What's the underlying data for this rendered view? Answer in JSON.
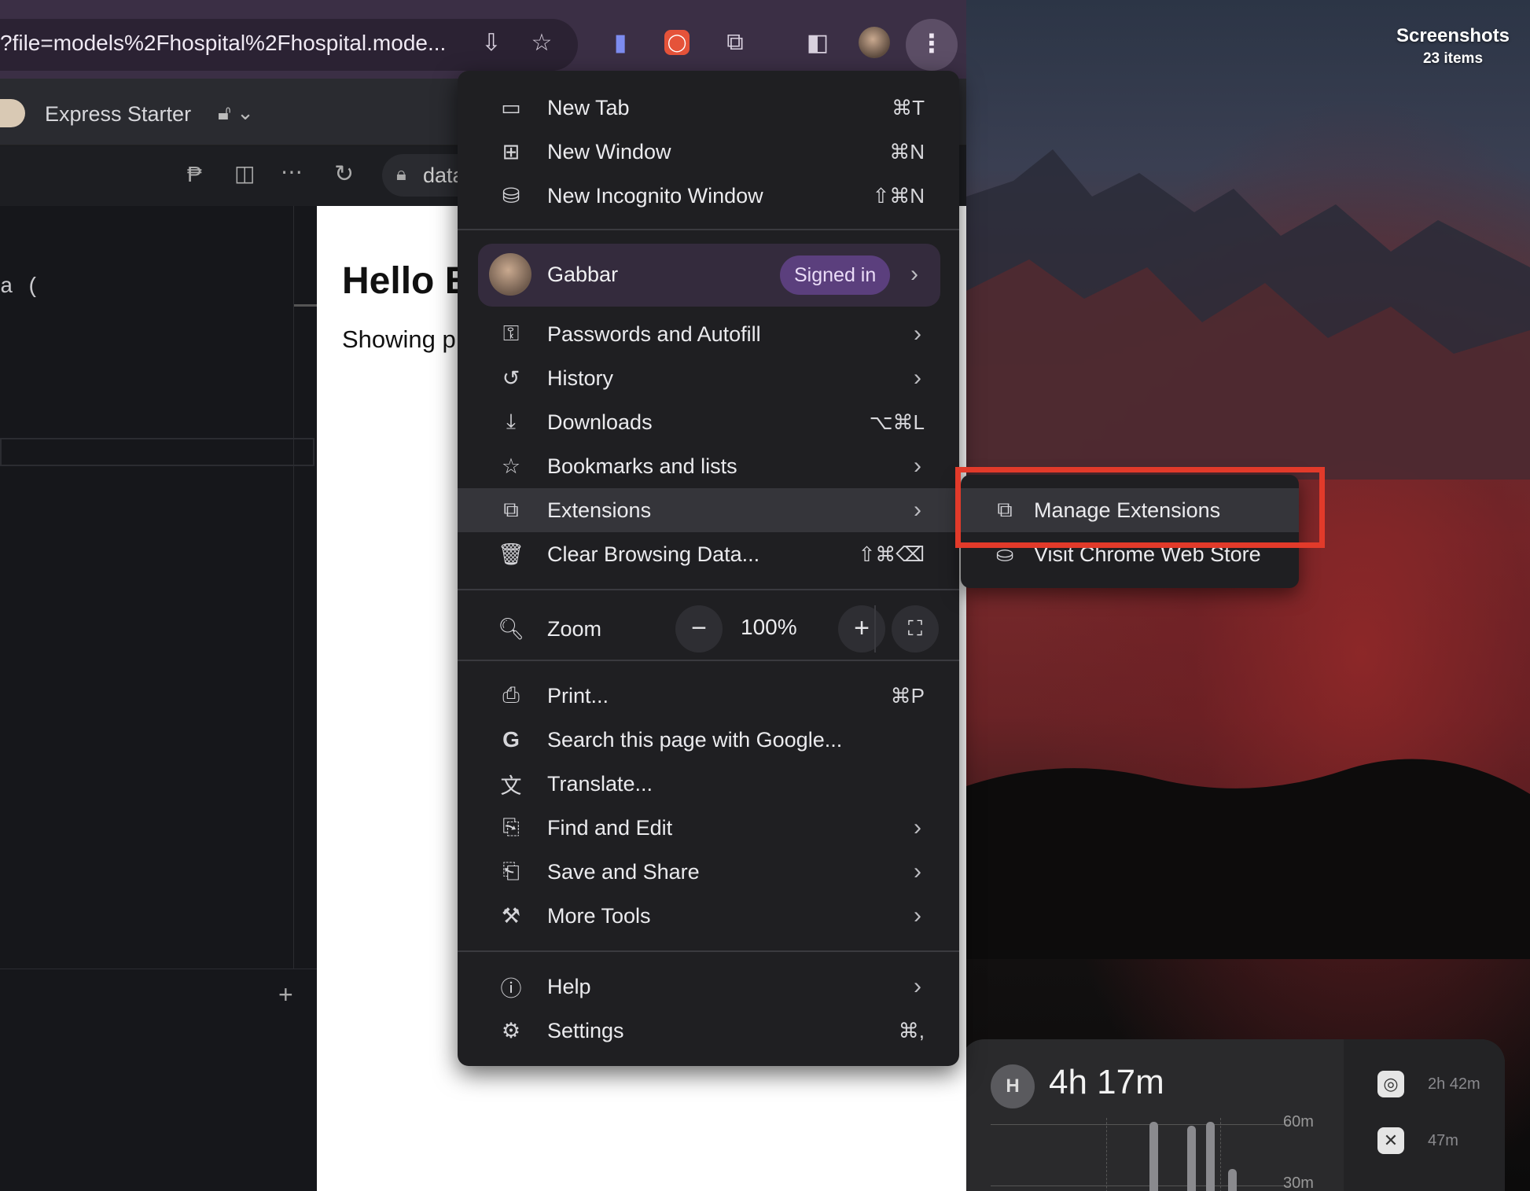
{
  "browser": {
    "url_text": "?file=models%2Fhospital%2Fhospital.mode...",
    "tab_title": "Express Starter",
    "address_chip": "data",
    "icons": [
      "install-icon",
      "star-icon",
      "bookmark-icon",
      "record-icon",
      "extensions-icon",
      "sidepanel-icon",
      "profile-avatar"
    ]
  },
  "editor": {
    "code_fragment": "a ("
  },
  "preview": {
    "heading": "Hello E",
    "text": "Showing p"
  },
  "menu": {
    "items_top": [
      {
        "label": "New Tab",
        "shortcut": "⌘T",
        "icon": "new-tab-icon"
      },
      {
        "label": "New Window",
        "shortcut": "⌘N",
        "icon": "new-window-icon"
      },
      {
        "label": "New Incognito Window",
        "shortcut": "⇧⌘N",
        "icon": "incognito-icon"
      }
    ],
    "profile": {
      "name": "Gabbar",
      "status": "Signed in"
    },
    "items_mid": [
      {
        "label": "Passwords and Autofill",
        "icon": "key-icon",
        "submenu": true
      },
      {
        "label": "History",
        "icon": "history-icon",
        "submenu": true
      },
      {
        "label": "Downloads",
        "shortcut": "⌥⌘L",
        "icon": "download-icon"
      },
      {
        "label": "Bookmarks and lists",
        "icon": "star-icon",
        "submenu": true
      },
      {
        "label": "Extensions",
        "icon": "puzzle-icon",
        "submenu": true,
        "active": true
      },
      {
        "label": "Clear Browsing Data...",
        "shortcut": "⇧⌘⌫",
        "icon": "trash-icon"
      }
    ],
    "zoom": {
      "label": "Zoom",
      "value": "100%",
      "minus": "−",
      "plus": "+"
    },
    "items_tools": [
      {
        "label": "Print...",
        "shortcut": "⌘P",
        "icon": "print-icon"
      },
      {
        "label": "Search this page with Google...",
        "icon": "google-icon"
      },
      {
        "label": "Translate...",
        "icon": "translate-icon"
      },
      {
        "label": "Find and Edit",
        "icon": "find-icon",
        "submenu": true
      },
      {
        "label": "Save and Share",
        "icon": "save-share-icon",
        "submenu": true
      },
      {
        "label": "More Tools",
        "icon": "toolbox-icon",
        "submenu": true
      }
    ],
    "items_bottom": [
      {
        "label": "Help",
        "icon": "help-icon",
        "submenu": true
      },
      {
        "label": "Settings",
        "shortcut": "⌘,",
        "icon": "gear-icon"
      }
    ]
  },
  "submenu": {
    "items": [
      {
        "label": "Manage Extensions",
        "icon": "puzzle-icon",
        "active": true
      },
      {
        "label": "Visit Chrome Web Store",
        "icon": "store-icon"
      }
    ]
  },
  "desktop": {
    "folder_title": "Screenshots",
    "folder_count": "23 items",
    "widget": {
      "avatar_letter": "H",
      "total": "4h 17m",
      "tick_high": "60m",
      "tick_low": "30m",
      "apps": [
        {
          "time": "2h 42m",
          "icon": "chrome-icon"
        },
        {
          "time": "47m",
          "icon": "vscode-icon"
        }
      ]
    }
  },
  "colors": {
    "highlight": "#e23a2a",
    "badge": "#5b3f7d",
    "menu_bg": "#1f1f22"
  }
}
